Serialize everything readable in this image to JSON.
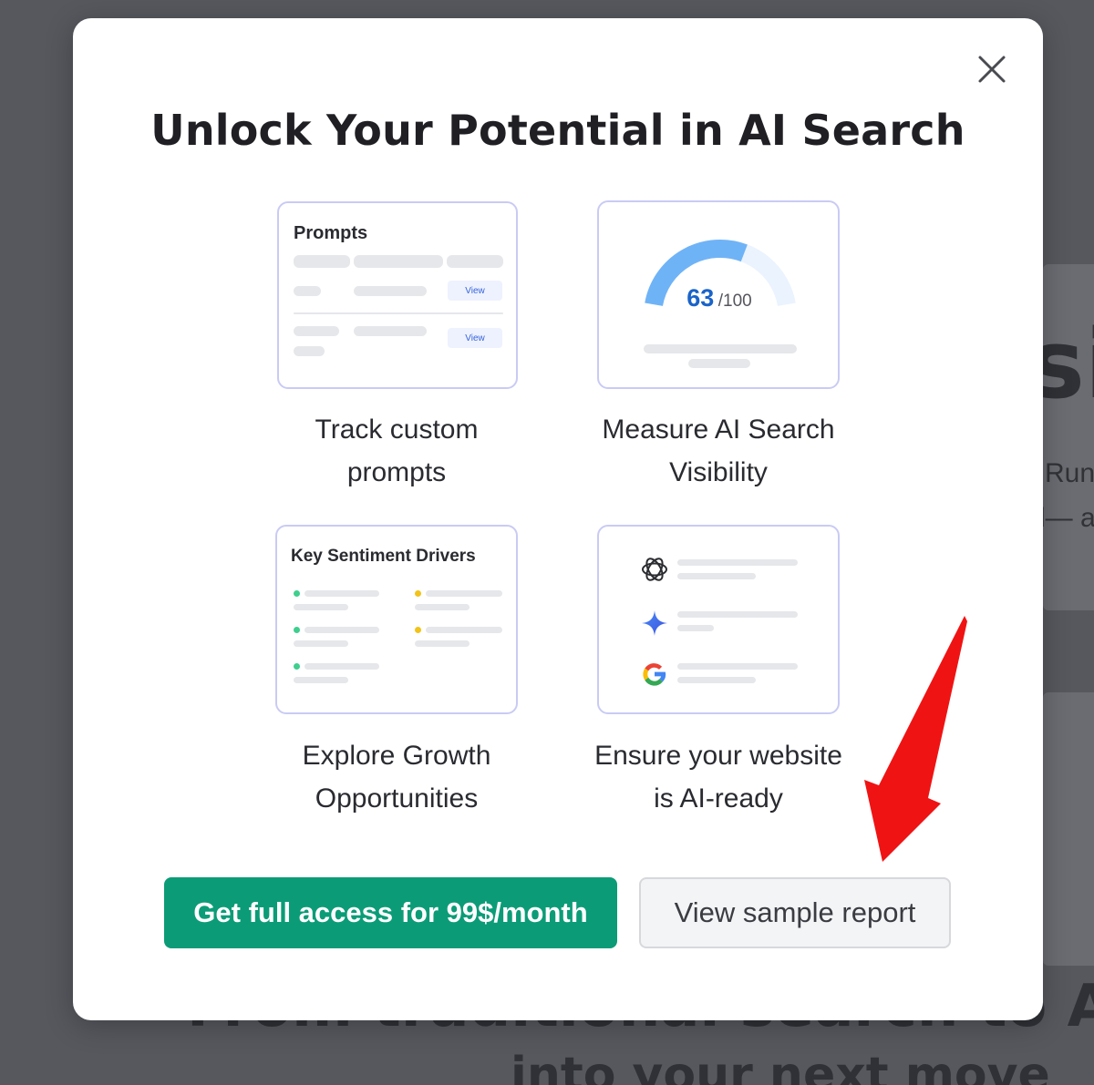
{
  "modal": {
    "title": "Unlock Your Potential in AI Search",
    "close_icon": "close-icon"
  },
  "features": [
    {
      "card_heading": "Prompts",
      "view_label_1": "View",
      "view_label_2": "View",
      "label_line1": "Track custom",
      "label_line2": "prompts"
    },
    {
      "score": "63",
      "score_max": "/100",
      "score_fraction": 0.63,
      "label_line1": "Measure AI Search",
      "label_line2": "Visibility"
    },
    {
      "card_heading": "Key Sentiment Drivers",
      "label_line1": "Explore Growth",
      "label_line2": "Opportunities"
    },
    {
      "icons": [
        "openai-icon",
        "gemini-sparkle-icon",
        "google-icon"
      ],
      "label_line1": "Ensure your website",
      "label_line2": "is AI-ready"
    }
  ],
  "buttons": {
    "primary_label": "Get full access for 99$/month",
    "secondary_label": "View sample report"
  },
  "background_page": {
    "fragment_right": "si",
    "fragment_run": "Run",
    "fragment_dash": "d— a",
    "fragment_bottom_1": "From traditional search to AI: turn",
    "fragment_bottom_2": "into your next move"
  },
  "colors": {
    "primary_button": "#0b9c77",
    "card_border": "#c9cbf4",
    "gauge_blue": "#6fb3f7",
    "score_blue": "#1a63c9",
    "arrow_red": "#f01313",
    "dot_green": "#3ecf8e",
    "dot_yellow": "#f2c318"
  }
}
